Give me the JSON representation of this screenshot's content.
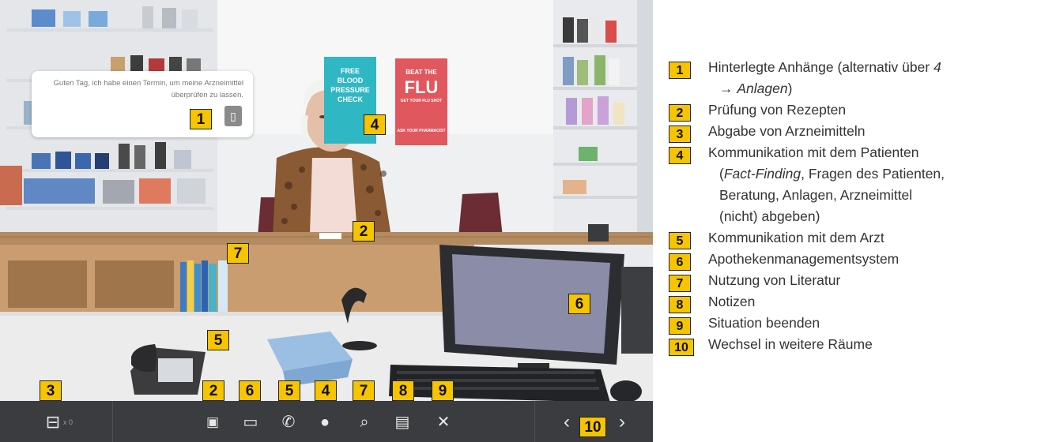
{
  "speech_bubble": {
    "text": "Guten Tag, ich habe einen Termin, um meine Arzneimittel überprüfen zu lassen.",
    "attachment_icon": "attachment-icon"
  },
  "posters": [
    {
      "line1": "FREE",
      "line2": "BLOOD",
      "line3": "PRESSURE",
      "line4": "CHECK",
      "color": "#2fb7c4"
    },
    {
      "line1": "BEAT THE",
      "line2": "FLU",
      "line3": "GET YOUR FLU SHOT",
      "line4": "ASK YOUR PHARMACIST",
      "color": "#e0585d"
    }
  ],
  "scene_badges": {
    "b1": "1",
    "b2": "2",
    "b4": "4",
    "b5": "5",
    "b6": "6",
    "b7": "7"
  },
  "toolbar_badges": {
    "b3": "3",
    "b2": "2",
    "b6": "6",
    "b5": "5",
    "b4": "4",
    "b7": "7",
    "b8": "8",
    "b9": "9",
    "b10": "10"
  },
  "toolbar": {
    "dispense_count": "x 0",
    "icons": [
      "dispense-icon",
      "prescription-check-icon",
      "monitor-icon",
      "phone-doctor-icon",
      "patient-icon",
      "literature-search-icon",
      "notes-icon",
      "close-icon",
      "chevron-left-icon",
      "chevron-right-icon"
    ]
  },
  "legend": [
    {
      "num": "1",
      "line1": "Hinterlegte Anhänge (alternativ über",
      "line1_italic": "4",
      "line2_arrow": "→",
      "line2_italic": "Anlagen",
      "line2_tail": ")"
    },
    {
      "num": "2",
      "text": "Prüfung von Rezepten"
    },
    {
      "num": "3",
      "text": "Abgabe von Arzneimitteln"
    },
    {
      "num": "4",
      "line1": "Kommunikation mit dem Patienten",
      "line2_open": "(",
      "line2_italic": "Fact-Finding",
      "line2_tail": ", Fragen des Patienten,",
      "line3": "Beratung, Anlagen, Arzneimittel",
      "line4": "(nicht) abgeben)"
    },
    {
      "num": "5",
      "text": "Kommunikation mit dem Arzt"
    },
    {
      "num": "6",
      "text": "Apothekenmanagementsystem"
    },
    {
      "num": "7",
      "text": "Nutzung von Literatur"
    },
    {
      "num": "8",
      "text": "Notizen"
    },
    {
      "num": "9",
      "text": "Situation beenden"
    },
    {
      "num": "10",
      "text": "Wechsel in weitere Räume"
    }
  ],
  "colors": {
    "badge": "#f6c400",
    "toolbar": "#3a3c3f"
  }
}
